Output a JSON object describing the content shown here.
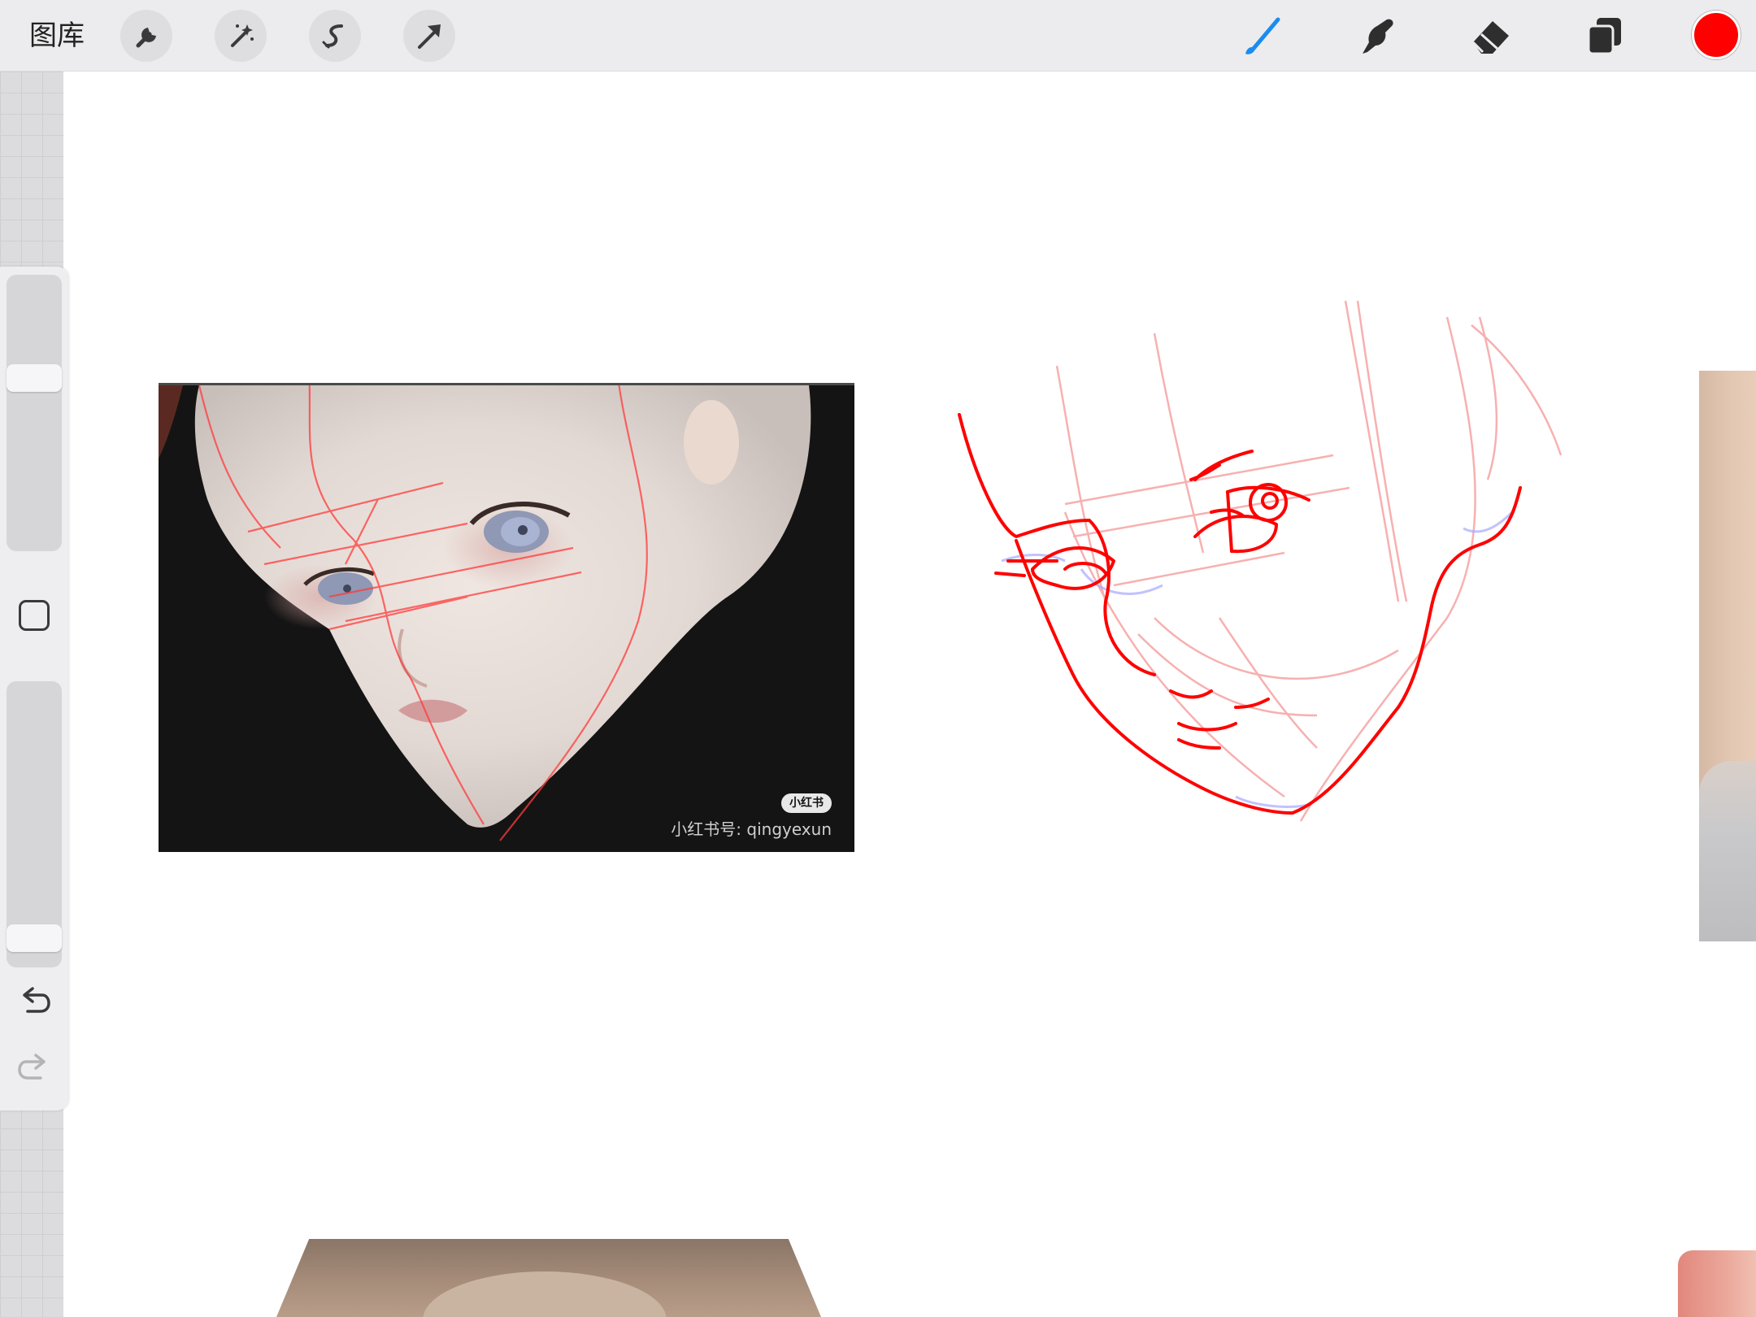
{
  "toolbar": {
    "gallery_label": "图库",
    "left_tools": [
      {
        "name": "actions",
        "icon": "wrench-icon"
      },
      {
        "name": "adjustments",
        "icon": "magic-wand-icon"
      },
      {
        "name": "selection",
        "icon": "selection-s-icon"
      },
      {
        "name": "transform",
        "icon": "arrow-cursor-icon"
      }
    ],
    "right_tools": [
      {
        "name": "brush",
        "icon": "brush-icon",
        "active": true
      },
      {
        "name": "smudge",
        "icon": "smudge-finger-icon"
      },
      {
        "name": "eraser",
        "icon": "eraser-icon"
      },
      {
        "name": "layers",
        "icon": "layers-icon"
      }
    ],
    "current_color": "#ff0000",
    "active_tool_color": "#1a8cf0"
  },
  "sidebar": {
    "brush_size_level": 0.64,
    "opacity_level": 0.06,
    "modify_button_icon": "square-outline-icon",
    "undo_icon": "undo-arrow-icon",
    "redo_icon": "redo-arrow-icon"
  },
  "canvas": {
    "reference_photo": {
      "watermark_badge": "小红书",
      "watermark_text": "小红书号: qingyexun"
    },
    "stroke_color": "#ff0000",
    "guide_color": "#f7a8a8"
  }
}
